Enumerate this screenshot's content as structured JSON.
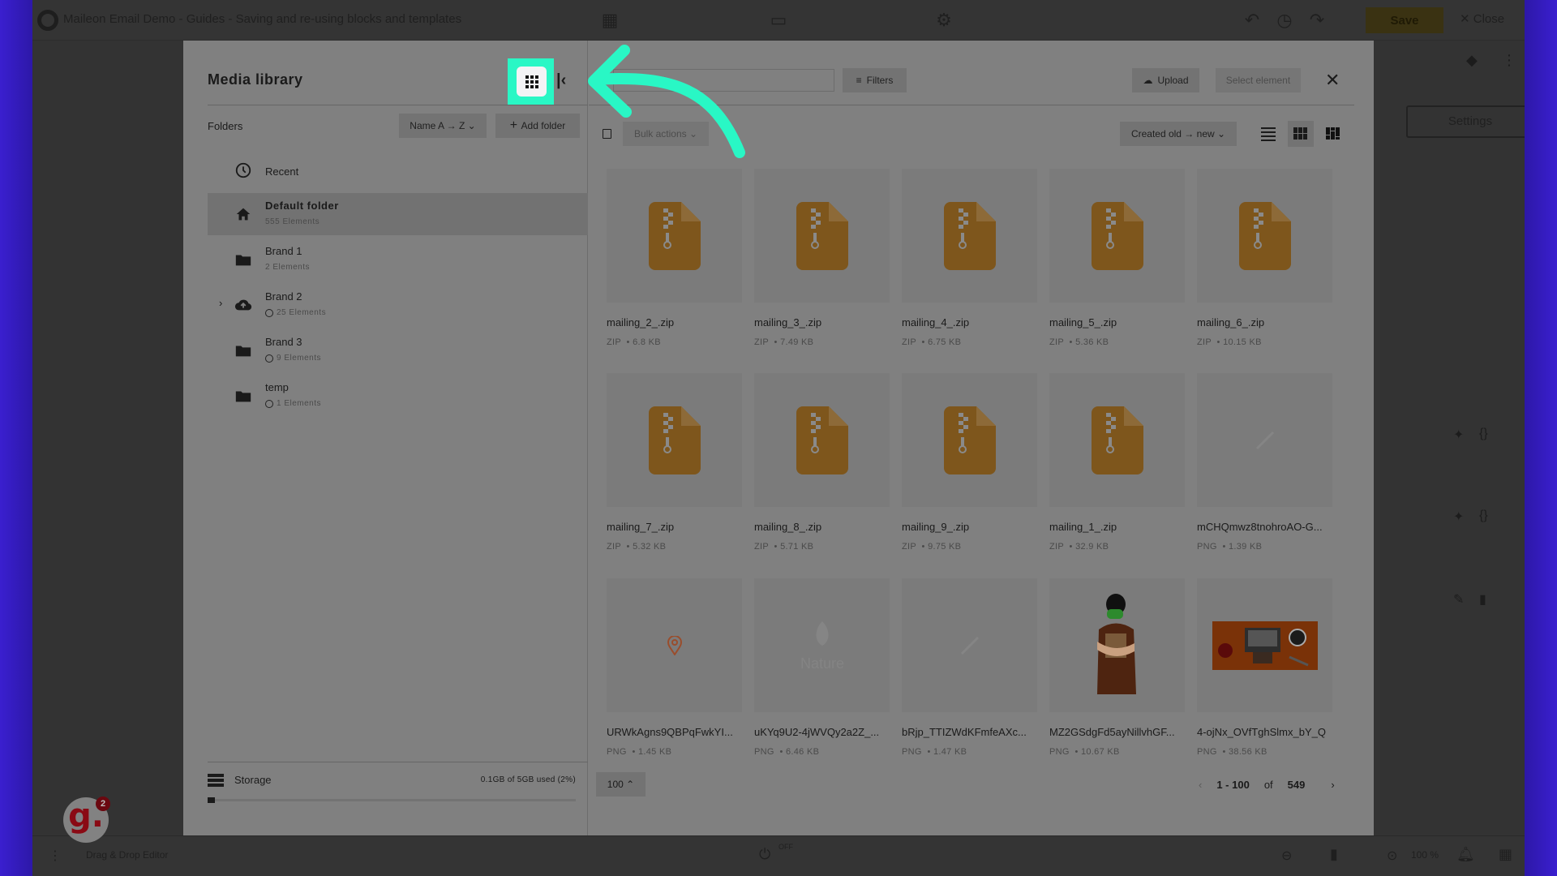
{
  "app": {
    "title": "Maileon Email Demo - Guides - Saving and re-using blocks and templates",
    "save_label": "Save",
    "close_label": "✕ Close",
    "settings_label": "Settings",
    "editor_mode_label": "Drag & Drop Editor",
    "autosave_label": "OFF",
    "zoom_label": "100 %",
    "notification_count": "2",
    "assistant_glyph": "g."
  },
  "dialog": {
    "title": "Media library",
    "folders_label": "Folders",
    "sort_label": "Name A → Z ⌄",
    "add_folder_label": "Add folder",
    "search_placeholder": "Search",
    "filters_label": "Filters",
    "upload_label": "Upload",
    "select_element_label": "Select element",
    "bulk_actions_label": "Bulk actions ⌄",
    "order_label": "Created old → new ⌄",
    "accent_color": "#29f7c5"
  },
  "folders": [
    {
      "name": "Recent",
      "count": "",
      "icon": "clock-icon",
      "shared": false,
      "selected": false
    },
    {
      "name": "Default folder",
      "count": "555 Elements",
      "icon": "home-icon",
      "shared": false,
      "selected": true
    },
    {
      "name": "Brand 1",
      "count": "2 Elements",
      "icon": "folder-icon",
      "shared": false,
      "selected": false
    },
    {
      "name": "Brand 2",
      "count": "25 Elements",
      "icon": "cloud-upload-icon",
      "shared": true,
      "selected": false,
      "expandable": true
    },
    {
      "name": "Brand 3",
      "count": "9 Elements",
      "icon": "folder-icon",
      "shared": true,
      "selected": false
    },
    {
      "name": "temp",
      "count": "1 Elements",
      "icon": "folder-icon",
      "shared": true,
      "selected": false
    }
  ],
  "storage": {
    "label": "Storage",
    "usage_text": "0.1GB of 5GB used (2%)",
    "used_percent": 2
  },
  "files": [
    {
      "name": "mailing_2_.zip",
      "type": "ZIP",
      "size": "6.8 KB",
      "thumb": "zip"
    },
    {
      "name": "mailing_3_.zip",
      "type": "ZIP",
      "size": "7.49 KB",
      "thumb": "zip"
    },
    {
      "name": "mailing_4_.zip",
      "type": "ZIP",
      "size": "6.75 KB",
      "thumb": "zip"
    },
    {
      "name": "mailing_5_.zip",
      "type": "ZIP",
      "size": "5.36 KB",
      "thumb": "zip"
    },
    {
      "name": "mailing_6_.zip",
      "type": "ZIP",
      "size": "10.15 KB",
      "thumb": "zip"
    },
    {
      "name": "mailing_7_.zip",
      "type": "ZIP",
      "size": "5.32 KB",
      "thumb": "zip"
    },
    {
      "name": "mailing_8_.zip",
      "type": "ZIP",
      "size": "5.71 KB",
      "thumb": "zip"
    },
    {
      "name": "mailing_9_.zip",
      "type": "ZIP",
      "size": "9.75 KB",
      "thumb": "zip"
    },
    {
      "name": "mailing_1_.zip",
      "type": "ZIP",
      "size": "32.9 KB",
      "thumb": "zip"
    },
    {
      "name": "mCHQmwz8tnohroAO-G...",
      "type": "PNG",
      "size": "1.39 KB",
      "thumb": "faint"
    },
    {
      "name": "URWkAgns9QBPqFwkYI...",
      "type": "PNG",
      "size": "1.45 KB",
      "thumb": "pin"
    },
    {
      "name": "uKYq9U2-4jWVQy2a2Z_...",
      "type": "PNG",
      "size": "6.46 KB",
      "thumb": "logo"
    },
    {
      "name": "bRjp_TTIZWdKFmfeAXc...",
      "type": "PNG",
      "size": "1.47 KB",
      "thumb": "faint"
    },
    {
      "name": "MZ2GSdgFd5ayNillvhGF...",
      "type": "PNG",
      "size": "10.67 KB",
      "thumb": "person"
    },
    {
      "name": "4-ojNx_OVfTghSlmx_bY_Q",
      "type": "PNG",
      "size": "38.56 KB",
      "thumb": "desk"
    }
  ],
  "pagination": {
    "per_page": "100 ⌃",
    "range": "1 - 100",
    "of_label": "of",
    "total": "549"
  }
}
